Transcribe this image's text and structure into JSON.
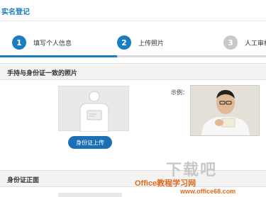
{
  "header": {
    "title": "实名登记"
  },
  "steps": [
    {
      "number": "1",
      "label": "填写个人信息"
    },
    {
      "number": "2",
      "label": "上传照片"
    },
    {
      "number": "3",
      "label": "人工审核"
    }
  ],
  "section1": {
    "title": "手持与身份证一致的照片",
    "upload_button": "身份证上传",
    "example_label": "示例："
  },
  "section2": {
    "title": "身份证正面"
  },
  "watermark": {
    "big": "下载吧",
    "line1": "Office教程学习网",
    "line2": "www.office68.com"
  },
  "colors": {
    "accent": "#1a7cc1",
    "inactive": "#c8c8c8",
    "watermark": "#e06a1c"
  }
}
